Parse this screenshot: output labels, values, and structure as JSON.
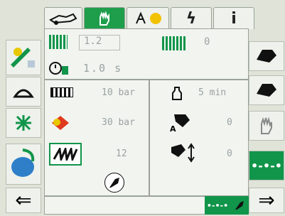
{
  "tabs": [
    {
      "icon": "tractor-icon"
    },
    {
      "icon": "glove-icon"
    },
    {
      "icon": "weather-icon"
    },
    {
      "icon": "lightning-icon"
    },
    {
      "label": "i"
    }
  ],
  "header": {
    "row1_value": "1.2",
    "row1_right_value": "0",
    "row2_value": "1.0 s"
  },
  "left_panel": {
    "pressure1": "10 bar",
    "pressure2": "30 bar",
    "level": "12"
  },
  "right_panel": {
    "time": "5 min",
    "auto_value": "0",
    "lift_value": "0"
  },
  "colors": {
    "accent_green": "#1e9e4b",
    "lcd_text": "#9aa3a3",
    "panel_bg": "#f2f4f0"
  }
}
